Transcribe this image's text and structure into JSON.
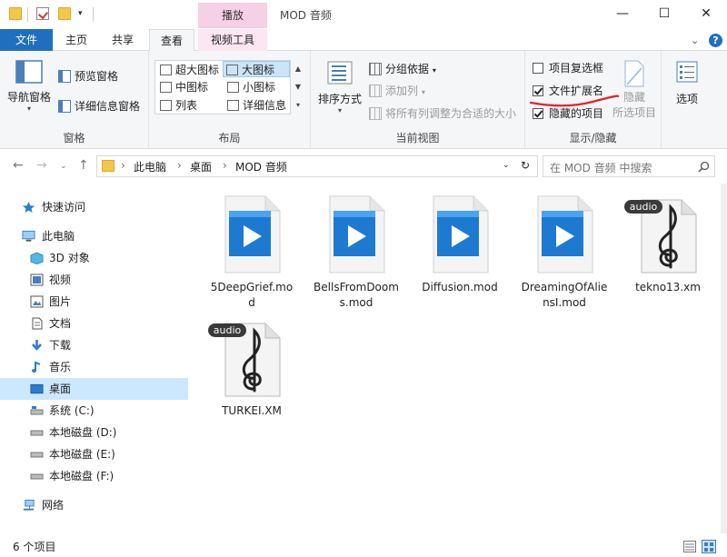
{
  "window": {
    "title": "MOD 音频",
    "context_tab_header": "播放",
    "controls": {
      "minimize": "—",
      "maximize": "☐",
      "close": "✕"
    }
  },
  "tabs": [
    {
      "label": "文件"
    },
    {
      "label": "主页"
    },
    {
      "label": "共享"
    },
    {
      "label": "查看"
    },
    {
      "label": "视频工具"
    }
  ],
  "ribbon": {
    "panes": {
      "label": "窗格",
      "nav_pane": "导航窗格",
      "preview": "预览窗格",
      "details": "详细信息窗格"
    },
    "layout": {
      "label": "布局",
      "items": [
        "超大图标",
        "大图标",
        "中图标",
        "小图标",
        "列表",
        "详细信息"
      ],
      "selected": "大图标"
    },
    "current_view": {
      "label": "当前视图",
      "sort": "排序方式",
      "group_by": "分组依据",
      "add_column": "添加列",
      "fit_columns": "将所有列调整为合适的大小"
    },
    "show_hide": {
      "label": "显示/隐藏",
      "item_checkboxes": "项目复选框",
      "file_extensions": "文件扩展名",
      "hidden_items": "隐藏的项目",
      "hide": "隐藏",
      "hide_sub": "所选项目",
      "item_checkboxes_checked": false,
      "file_extensions_checked": true,
      "hidden_items_checked": true
    },
    "options": "选项",
    "annotation_color": "#e8202a"
  },
  "address": {
    "crumbs": [
      "此电脑",
      "桌面",
      "MOD 音频"
    ],
    "search_placeholder": "在 MOD 音频 中搜索"
  },
  "nav": [
    {
      "label": "快速访问",
      "icon": "star-icon"
    },
    {
      "label": "此电脑",
      "icon": "computer-icon"
    },
    {
      "label": "3D 对象",
      "icon": "cube-icon"
    },
    {
      "label": "视频",
      "icon": "video-icon"
    },
    {
      "label": "图片",
      "icon": "picture-icon"
    },
    {
      "label": "文档",
      "icon": "document-icon"
    },
    {
      "label": "下载",
      "icon": "download-icon"
    },
    {
      "label": "音乐",
      "icon": "music-icon"
    },
    {
      "label": "桌面",
      "icon": "desktop-icon"
    },
    {
      "label": "系统 (C:)",
      "icon": "drive-icon"
    },
    {
      "label": "本地磁盘 (D:)",
      "icon": "drive-icon"
    },
    {
      "label": "本地磁盘 (E:)",
      "icon": "drive-icon"
    },
    {
      "label": "本地磁盘 (F:)",
      "icon": "drive-icon"
    },
    {
      "label": "网络",
      "icon": "network-icon"
    }
  ],
  "files": [
    {
      "name": "5DeepGrief.mod",
      "type": "video"
    },
    {
      "name": "BellsFromDooms.mod",
      "type": "video"
    },
    {
      "name": "Diffusion.mod",
      "type": "video"
    },
    {
      "name": "DreamingOfAliensI.mod",
      "type": "video"
    },
    {
      "name": "tekno13.xm",
      "type": "audio",
      "badge": "audio"
    },
    {
      "name": "TURKEI.XM",
      "type": "audio",
      "badge": "audio"
    }
  ],
  "status": {
    "count": "6 个项目"
  }
}
